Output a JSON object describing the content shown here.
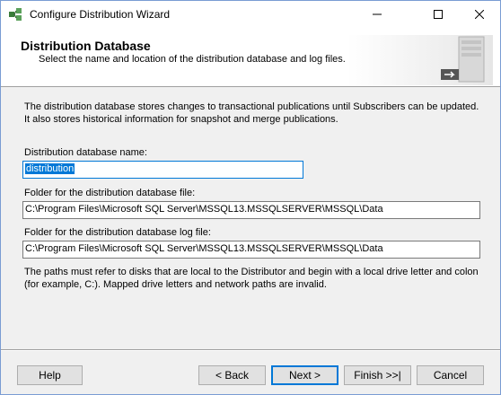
{
  "window": {
    "title": "Configure Distribution Wizard"
  },
  "header": {
    "title": "Distribution Database",
    "subtitle": "Select the name and location of the distribution database and log files."
  },
  "main": {
    "description": "The distribution database stores changes to transactional publications until Subscribers can be updated. It also stores historical information for snapshot and merge publications.",
    "db_name_label": "Distribution database name:",
    "db_name_value": "distribution",
    "data_folder_label": "Folder for the distribution database file:",
    "data_folder_value": "C:\\Program Files\\Microsoft SQL Server\\MSSQL13.MSSQLSERVER\\MSSQL\\Data",
    "log_folder_label": "Folder for the distribution database log file:",
    "log_folder_value": "C:\\Program Files\\Microsoft SQL Server\\MSSQL13.MSSQLSERVER\\MSSQL\\Data",
    "note": "The paths must refer to disks that are local to the Distributor and begin with a local drive letter and colon (for example, C:). Mapped drive letters and network paths are invalid."
  },
  "buttons": {
    "help": "Help",
    "back": "< Back",
    "next": "Next >",
    "finish": "Finish >>|",
    "cancel": "Cancel"
  },
  "icons": {
    "app": "wizard-app-icon",
    "header": "distribution-server-icon"
  },
  "colors": {
    "accent": "#0078d7",
    "selection": "#0078d7"
  }
}
